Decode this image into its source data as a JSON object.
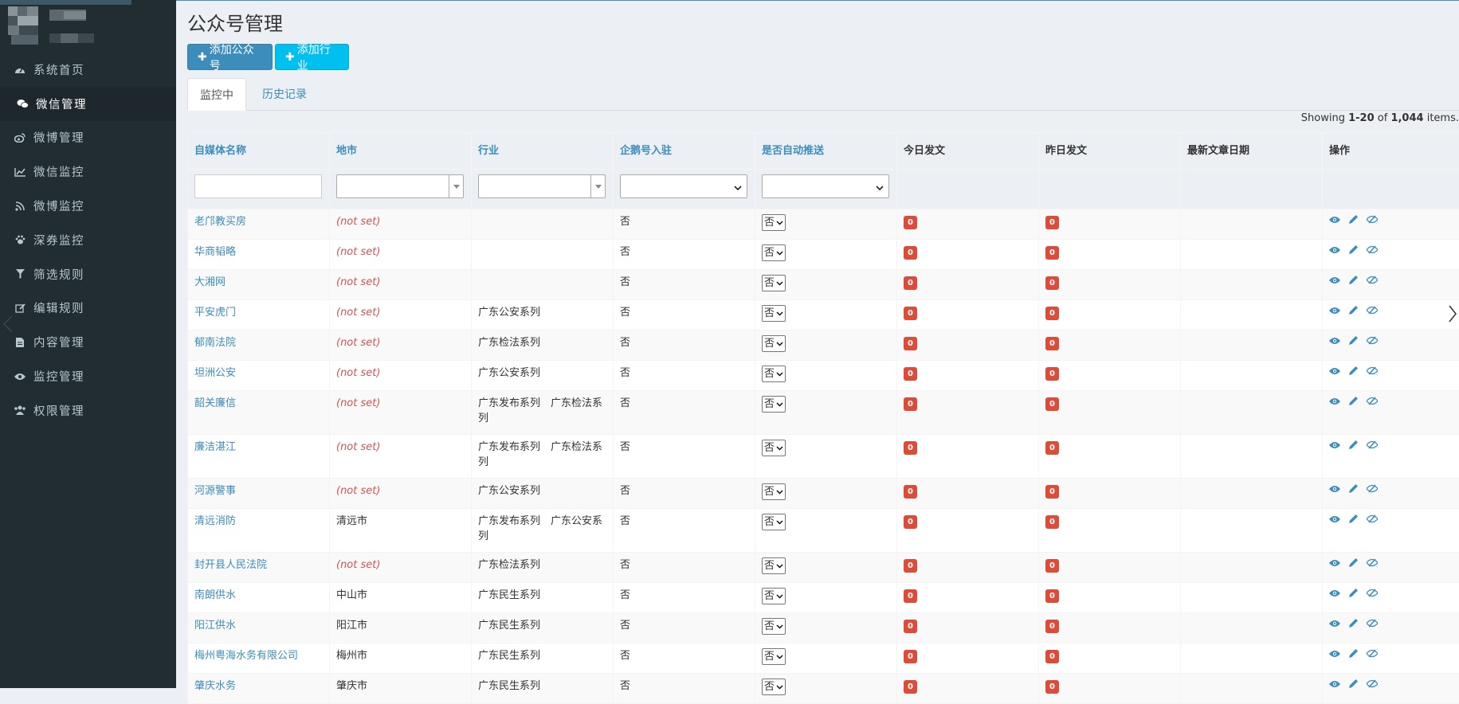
{
  "colors": {
    "accent": "#3c8dbc",
    "info": "#00c0ef",
    "danger": "#dd4b39",
    "sidebar": "#222d32"
  },
  "sidebar": {
    "items": [
      {
        "label": "系统首页",
        "icon": "dashboard-icon"
      },
      {
        "label": "微信管理",
        "icon": "wechat-icon"
      },
      {
        "label": "微博管理",
        "icon": "weibo-icon"
      },
      {
        "label": "微信监控",
        "icon": "line-chart-icon"
      },
      {
        "label": "微博监控",
        "icon": "rss-icon"
      },
      {
        "label": "深券监控",
        "icon": "paw-icon"
      },
      {
        "label": "筛选规则",
        "icon": "filter-icon"
      },
      {
        "label": "编辑规则",
        "icon": "edit-icon"
      },
      {
        "label": "内容管理",
        "icon": "file-icon"
      },
      {
        "label": "监控管理",
        "icon": "eye-icon"
      },
      {
        "label": "权限管理",
        "icon": "users-icon"
      }
    ]
  },
  "page": {
    "title": "公众号管理",
    "add_account": "添加公众号",
    "add_industry": "添加行业",
    "tab_active": "监控中",
    "tab_history": "历史记录"
  },
  "summary": {
    "prefix": "Showing ",
    "range": "1-20",
    "of": " of ",
    "total": "1,044",
    "suffix": " items."
  },
  "table": {
    "columns": [
      "自媒体名称",
      "地市",
      "行业",
      "企鹅号入驻",
      "是否自动推送",
      "今日发文",
      "昨日发文",
      "最新文章日期",
      "操作"
    ],
    "rows": [
      {
        "name": "老邝教买房",
        "city": "(not set)",
        "industry": "",
        "penguin": "否",
        "push": "否",
        "today": "0",
        "yesterday": "0",
        "latest": ""
      },
      {
        "name": "华商韬略",
        "city": "(not set)",
        "industry": "",
        "penguin": "否",
        "push": "否",
        "today": "0",
        "yesterday": "0",
        "latest": ""
      },
      {
        "name": "大湘网",
        "city": "(not set)",
        "industry": "",
        "penguin": "否",
        "push": "否",
        "today": "0",
        "yesterday": "0",
        "latest": ""
      },
      {
        "name": "平安虎门",
        "city": "(not set)",
        "industry": "广东公安系列",
        "penguin": "否",
        "push": "否",
        "today": "0",
        "yesterday": "0",
        "latest": ""
      },
      {
        "name": "郁南法院",
        "city": "(not set)",
        "industry": "广东检法系列",
        "penguin": "否",
        "push": "否",
        "today": "0",
        "yesterday": "0",
        "latest": ""
      },
      {
        "name": "坦洲公安",
        "city": "(not set)",
        "industry": "广东公安系列",
        "penguin": "否",
        "push": "否",
        "today": "0",
        "yesterday": "0",
        "latest": ""
      },
      {
        "name": "韶关廉信",
        "city": "(not set)",
        "industry": "广东发布系列　广东检法系列",
        "penguin": "否",
        "push": "否",
        "today": "0",
        "yesterday": "0",
        "latest": ""
      },
      {
        "name": "廉洁湛江",
        "city": "(not set)",
        "industry": "广东发布系列　广东检法系列",
        "penguin": "否",
        "push": "否",
        "today": "0",
        "yesterday": "0",
        "latest": ""
      },
      {
        "name": "河源警事",
        "city": "(not set)",
        "industry": "广东公安系列",
        "penguin": "否",
        "push": "否",
        "today": "0",
        "yesterday": "0",
        "latest": ""
      },
      {
        "name": "清远消防",
        "city": "清远市",
        "industry": "广东发布系列　广东公安系列",
        "penguin": "否",
        "push": "否",
        "today": "0",
        "yesterday": "0",
        "latest": ""
      },
      {
        "name": "封开县人民法院",
        "city": "(not set)",
        "industry": "广东检法系列",
        "penguin": "否",
        "push": "否",
        "today": "0",
        "yesterday": "0",
        "latest": ""
      },
      {
        "name": "南朗供水",
        "city": "中山市",
        "industry": "广东民生系列",
        "penguin": "否",
        "push": "否",
        "today": "0",
        "yesterday": "0",
        "latest": ""
      },
      {
        "name": "阳江供水",
        "city": "阳江市",
        "industry": "广东民生系列",
        "penguin": "否",
        "push": "否",
        "today": "0",
        "yesterday": "0",
        "latest": ""
      },
      {
        "name": "梅州粤海水务有限公司",
        "city": "梅州市",
        "industry": "广东民生系列",
        "penguin": "否",
        "push": "否",
        "today": "0",
        "yesterday": "0",
        "latest": ""
      },
      {
        "name": "肇庆水务",
        "city": "肇庆市",
        "industry": "广东民生系列",
        "penguin": "否",
        "push": "否",
        "today": "0",
        "yesterday": "0",
        "latest": ""
      }
    ]
  }
}
